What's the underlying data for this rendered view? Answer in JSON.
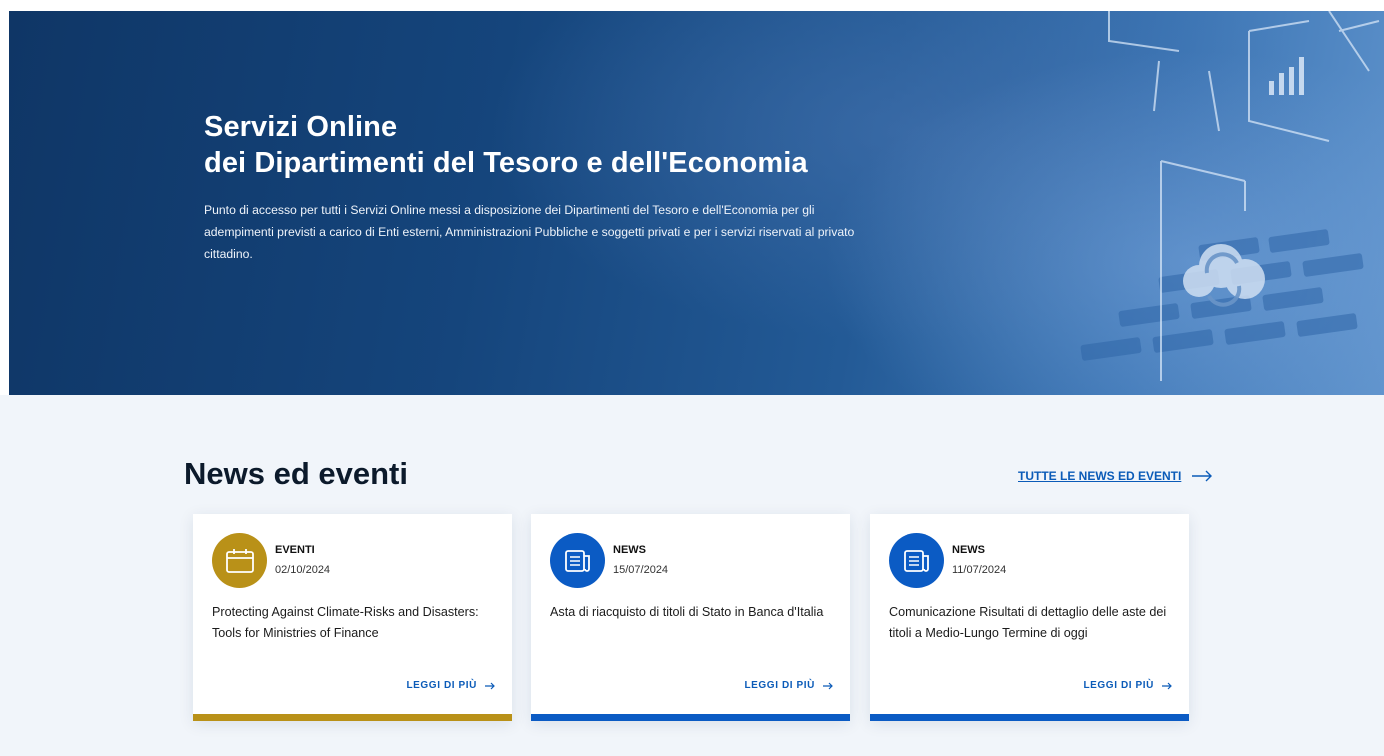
{
  "hero": {
    "title_line1": "Servizi Online",
    "title_line2": "dei Dipartimenti del Tesoro e dell'Economia",
    "description": "Punto di accesso per tutti i Servizi Online messi a disposizione dei Dipartimenti del Tesoro e dell'Economia per gli adempimenti previsti a carico di Enti esterni, Amministrazioni Pubbliche e soggetti privati e per i servizi riservati al privato cittadino."
  },
  "news": {
    "heading": "News ed eventi",
    "all_link_label": "TUTTE LE NEWS ED EVENTI",
    "cards": [
      {
        "category": "EVENTI",
        "date": "02/10/2024",
        "title": "Protecting Against Climate-Risks and Disasters: Tools for Ministries of Finance",
        "more_label": "LEGGI DI PIÙ",
        "icon": "calendar-icon",
        "accent_color": "#b99118"
      },
      {
        "category": "NEWS",
        "date": "15/07/2024",
        "title": "Asta di riacquisto di titoli di Stato in Banca d'Italia",
        "more_label": "LEGGI DI PIÙ",
        "icon": "newspaper-icon",
        "accent_color": "#0b5bc4"
      },
      {
        "category": "NEWS",
        "date": "11/07/2024",
        "title": "Comunicazione Risultati di dettaglio delle aste dei titoli a Medio-Lungo Termine di oggi",
        "more_label": "LEGGI DI PIÙ",
        "icon": "newspaper-icon",
        "accent_color": "#0b5bc4"
      }
    ]
  }
}
